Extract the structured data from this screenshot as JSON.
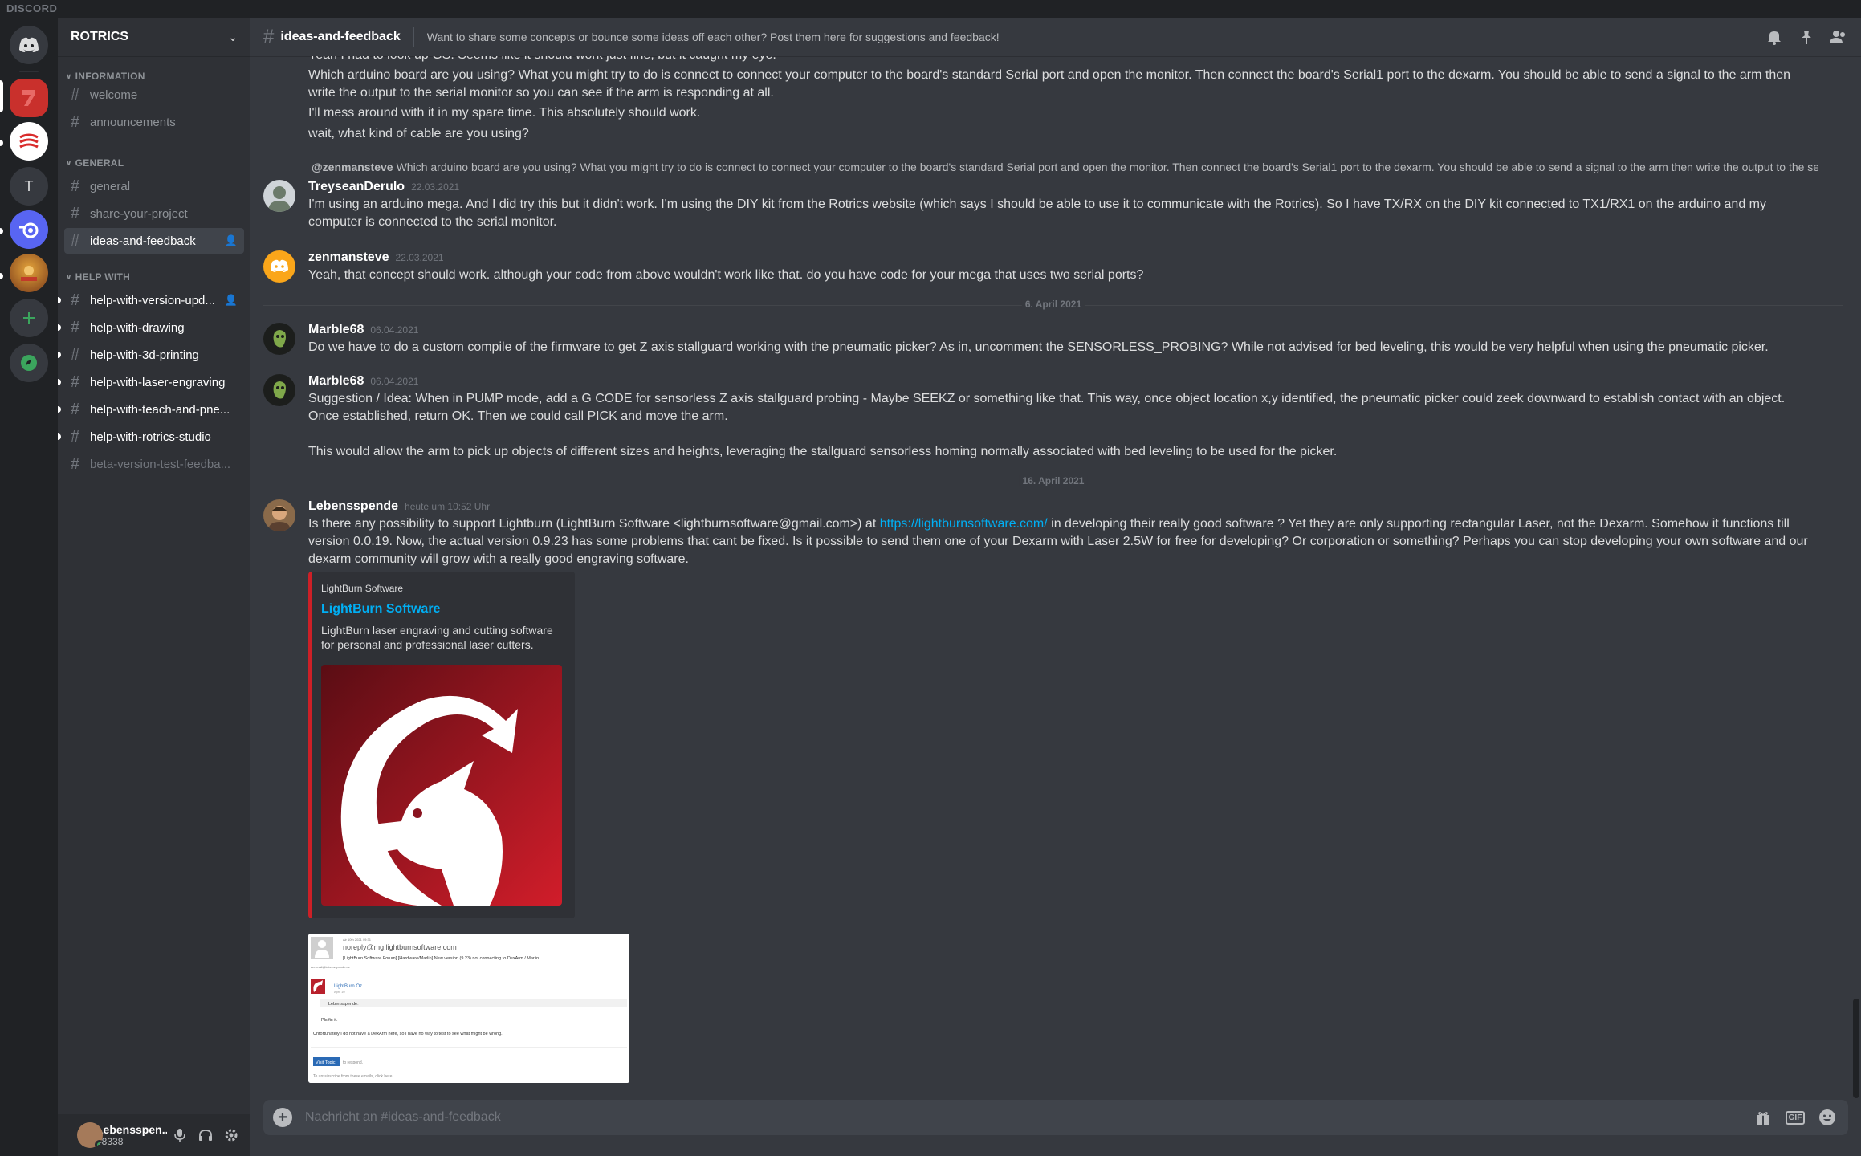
{
  "app": {
    "brand": "DISCORD"
  },
  "server": {
    "name": "ROTRICS"
  },
  "categories": {
    "information": "INFORMATION",
    "general": "GENERAL",
    "help": "HELP WITH"
  },
  "channels": {
    "welcome": "welcome",
    "announcements": "announcements",
    "general": "general",
    "share": "share-your-project",
    "ideas": "ideas-and-feedback",
    "help_version": "help-with-version-upd...",
    "help_drawing": "help-with-drawing",
    "help_3d": "help-with-3d-printing",
    "help_laser": "help-with-laser-engraving",
    "help_teach": "help-with-teach-and-pne...",
    "help_studio": "help-with-rotrics-studio",
    "beta": "beta-version-test-feedba..."
  },
  "user": {
    "name": "Lebensspen...",
    "tag": "#8338"
  },
  "header": {
    "channel": "ideas-and-feedback",
    "topic": "Want to share some concepts or bounce some ideas off each other? Post them here for suggestions and feedback!"
  },
  "messages": {
    "m0_l1": "Yeah I had to look up GS. Seems like it should work just fine, but it caught my eye.",
    "m0_l2": "Which arduino board are you using? What you might try to do is connect to connect your computer to the board's standard Serial port and open the monitor. Then connect the board's  Serial1 port to the dexarm. You should be able to send a signal to the arm then write the output to the serial monitor so you can see if the arm is responding at all.",
    "m0_l3": "I'll mess around with it in my spare time. This absolutely should work.",
    "m0_l4": "wait, what kind of cable are you using?",
    "reply1_name": "@zenmansteve",
    "reply1_text": "Which arduino board are you using? What you might try to do is connect to connect your computer to the board's standard Serial port and open the monitor. Then connect the board's  Serial1 port to the dexarm. You should be able to send a signal to the arm then write the output to the serial monitor s...",
    "m1_author": "TreyseanDerulo",
    "m1_ts": "22.03.2021",
    "m1_text": "I'm using an arduino mega. And I did try this but it didn't work. I'm using the DIY kit from the Rotrics website (which says I should be able to use it to communicate with the Rotrics). So I have TX/RX on the DIY kit connected to TX1/RX1 on the arduino and my computer is connected to the serial monitor.",
    "m2_author": "zenmansteve",
    "m2_ts": "22.03.2021",
    "m2_text": "Yeah, that concept should work. although your code from above wouldn't work like that. do you have code for your mega that uses two serial ports?",
    "date1": "6. April 2021",
    "m3_author": "Marble68",
    "m3_ts": "06.04.2021",
    "m3_text": "Do we have to do a custom compile of the firmware to get Z axis stallguard working with the pneumatic picker? As in, uncomment the SENSORLESS_PROBING? While not advised for bed leveling, this would be very helpful when using the pneumatic picker.",
    "m4_author": "Marble68",
    "m4_ts": "06.04.2021",
    "m4_text": "Suggestion / Idea: When in PUMP mode, add a G CODE for sensorless Z axis stallguard probing - Maybe SEEKZ or something like that. This way, once object location x,y identified, the pneumatic picker could zeek downward to establish contact with an object. Once established, return OK. Then we could call PICK and move the arm.",
    "m4_text2": "This would allow the arm to pick up objects of different sizes and heights, leveraging the stallguard sensorless homing normally associated with bed leveling to be used for the picker.",
    "date2": "16. April 2021",
    "m5_author": "Lebensspende",
    "m5_ts": "heute um 10:52 Uhr",
    "m5_pre": "Is there any possibility to support Lightburn (LightBurn Software <lightburnsoftware@gmail.com>) at ",
    "m5_link": "https://lightburnsoftware.com/",
    "m5_post": " in developing their really good software ? Yet they are only supporting rectangular Laser, not the Dexarm. Somehow it functions till version 0.0.19. Now, the actual version 0.9.23 has some problems that cant be fixed. Is it possible to send them one of your Dexarm with Laser 2.5W for free for developing? Or corporation or something? Perhaps you can stop developing your own software and our dexarm community will grow with a really good engraving software."
  },
  "embed": {
    "provider": "LightBurn Software",
    "title": "LightBurn Software",
    "description": "LightBurn laser engraving and cutting software for personal and professional laser cutters."
  },
  "attachment": {
    "date": "Air 10th 2021 / 9:31",
    "from": "noreply@mg.lightburnsoftware.com",
    "subject": "[LightBurn Software Forum] [Hardware/Marlin] New version (9.23) not connecting to DexArm / Marlin",
    "to": "An: mail@lebensspende.de",
    "rname": "LightBurn Oz",
    "rdate": "April 10",
    "quote": "Lebensspende:",
    "fix": "Pls fix it.",
    "body": "Unfortunately I do not have a DexArm here, so I have no way to test to see what might be wrong.",
    "visit": "Visit Topic",
    "visit_after": "to respond.",
    "unsub": "To unsubscribe from these emails, click here."
  },
  "composer": {
    "placeholder": "Nachricht an #ideas-and-feedback"
  },
  "colors": {
    "accent": "#00aff4",
    "embed_border": "#cd2027",
    "online": "#3ba55d",
    "bg": "#36393f"
  }
}
